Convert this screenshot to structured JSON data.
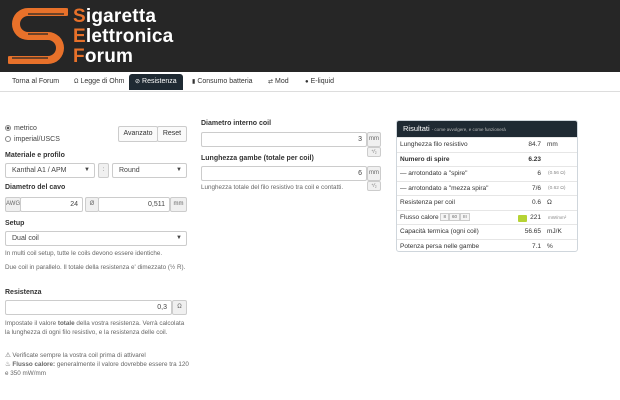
{
  "header": {
    "logo_lines": [
      "Sigaretta",
      "Elettronica",
      "Forum"
    ],
    "accent": "#e8712a",
    "bg": "#262626"
  },
  "nav": [
    {
      "label": "Torna al Forum",
      "icon": ""
    },
    {
      "label": "Legge di Ohm",
      "icon": "omega-icon"
    },
    {
      "label": "Resistenza",
      "icon": "link-icon",
      "active": true
    },
    {
      "label": "Consumo batteria",
      "icon": "bar-chart-icon"
    },
    {
      "label": "Mod",
      "icon": "swap-icon"
    },
    {
      "label": "E-liquid",
      "icon": "drop-icon"
    }
  ],
  "units": {
    "metric": "metrico",
    "imperial": "imperial/USCS",
    "advanced_btn": "Avanzato",
    "reset_btn": "Reset"
  },
  "material": {
    "label": "Materiale e profilo",
    "material_value": "Kanthal A1 / APM",
    "separator": ":",
    "profile_value": "Round"
  },
  "wire": {
    "label": "Diametro del cavo",
    "awg_addon": "AWG",
    "awg_value": "24",
    "diam_addon": "Ø",
    "diam_value": "0,511",
    "unit_addon": "mm"
  },
  "setup": {
    "label": "Setup",
    "value": "Dual coil",
    "help1": "In multi coil setup, tutte le coils devono essere identiche.",
    "help2": "Due coil in parallelo. Il totale della resistenza e' dimezzato (½ R)."
  },
  "resistance": {
    "label": "Resistenza",
    "value": "0,3",
    "unit": "Ω",
    "help_pre": "Impostate il valore ",
    "help_bold": "totale",
    "help_post": " della vostra resistenza. Verrà calcolata la lunghezza di ogni filo resistivo, e la resistenza delle coil."
  },
  "notes": {
    "warn": "Verificate sempre la vostra coil prima di attivarel",
    "flux_bold": "Flusso calore:",
    "flux_text": " generalmente il valore dovrebbe essere tra 120 e 350 mW/mm"
  },
  "coil": {
    "inner_label": "Diametro interno coil",
    "inner_value": "3",
    "inner_unit": "mm",
    "legs_label": "Lunghezza gambe (totale per coil)",
    "legs_value": "6",
    "legs_unit": "⁺⁄₂",
    "legs_help": "Lunghezza totale del filo resistivo tra coil e contatti.",
    "inner_unit2": "⁺⁄₂"
  },
  "results": {
    "title": "Risultati",
    "subtitle": "- come avvolgere, e come funzionerà",
    "rows": [
      {
        "k": "Lunghezza filo resistivo",
        "v": "84.7",
        "u": "mm"
      },
      {
        "k": "Numero di spire",
        "v": "6.23",
        "u": "",
        "bold": true
      },
      {
        "k": "— arrotondato a \"spire\"",
        "v": "6",
        "s": "(0.56 Ω)"
      },
      {
        "k": "— arrotondato a \"mezza spira\"",
        "v": "7/6",
        "s": "(0.62 Ω)"
      },
      {
        "k": "Resistenza per coil",
        "v": "0.6",
        "u": "Ω"
      },
      {
        "k": "Flusso calore",
        "v": "221",
        "u": "mW/mm²",
        "mini": [
          "8",
          "60",
          "III"
        ]
      },
      {
        "k": "Capacità termica (ogni coil)",
        "v": "56.65",
        "u": "mJ/K"
      },
      {
        "k": "Potenza persa nelle gambe",
        "v": "7.1",
        "u": "%"
      }
    ]
  }
}
